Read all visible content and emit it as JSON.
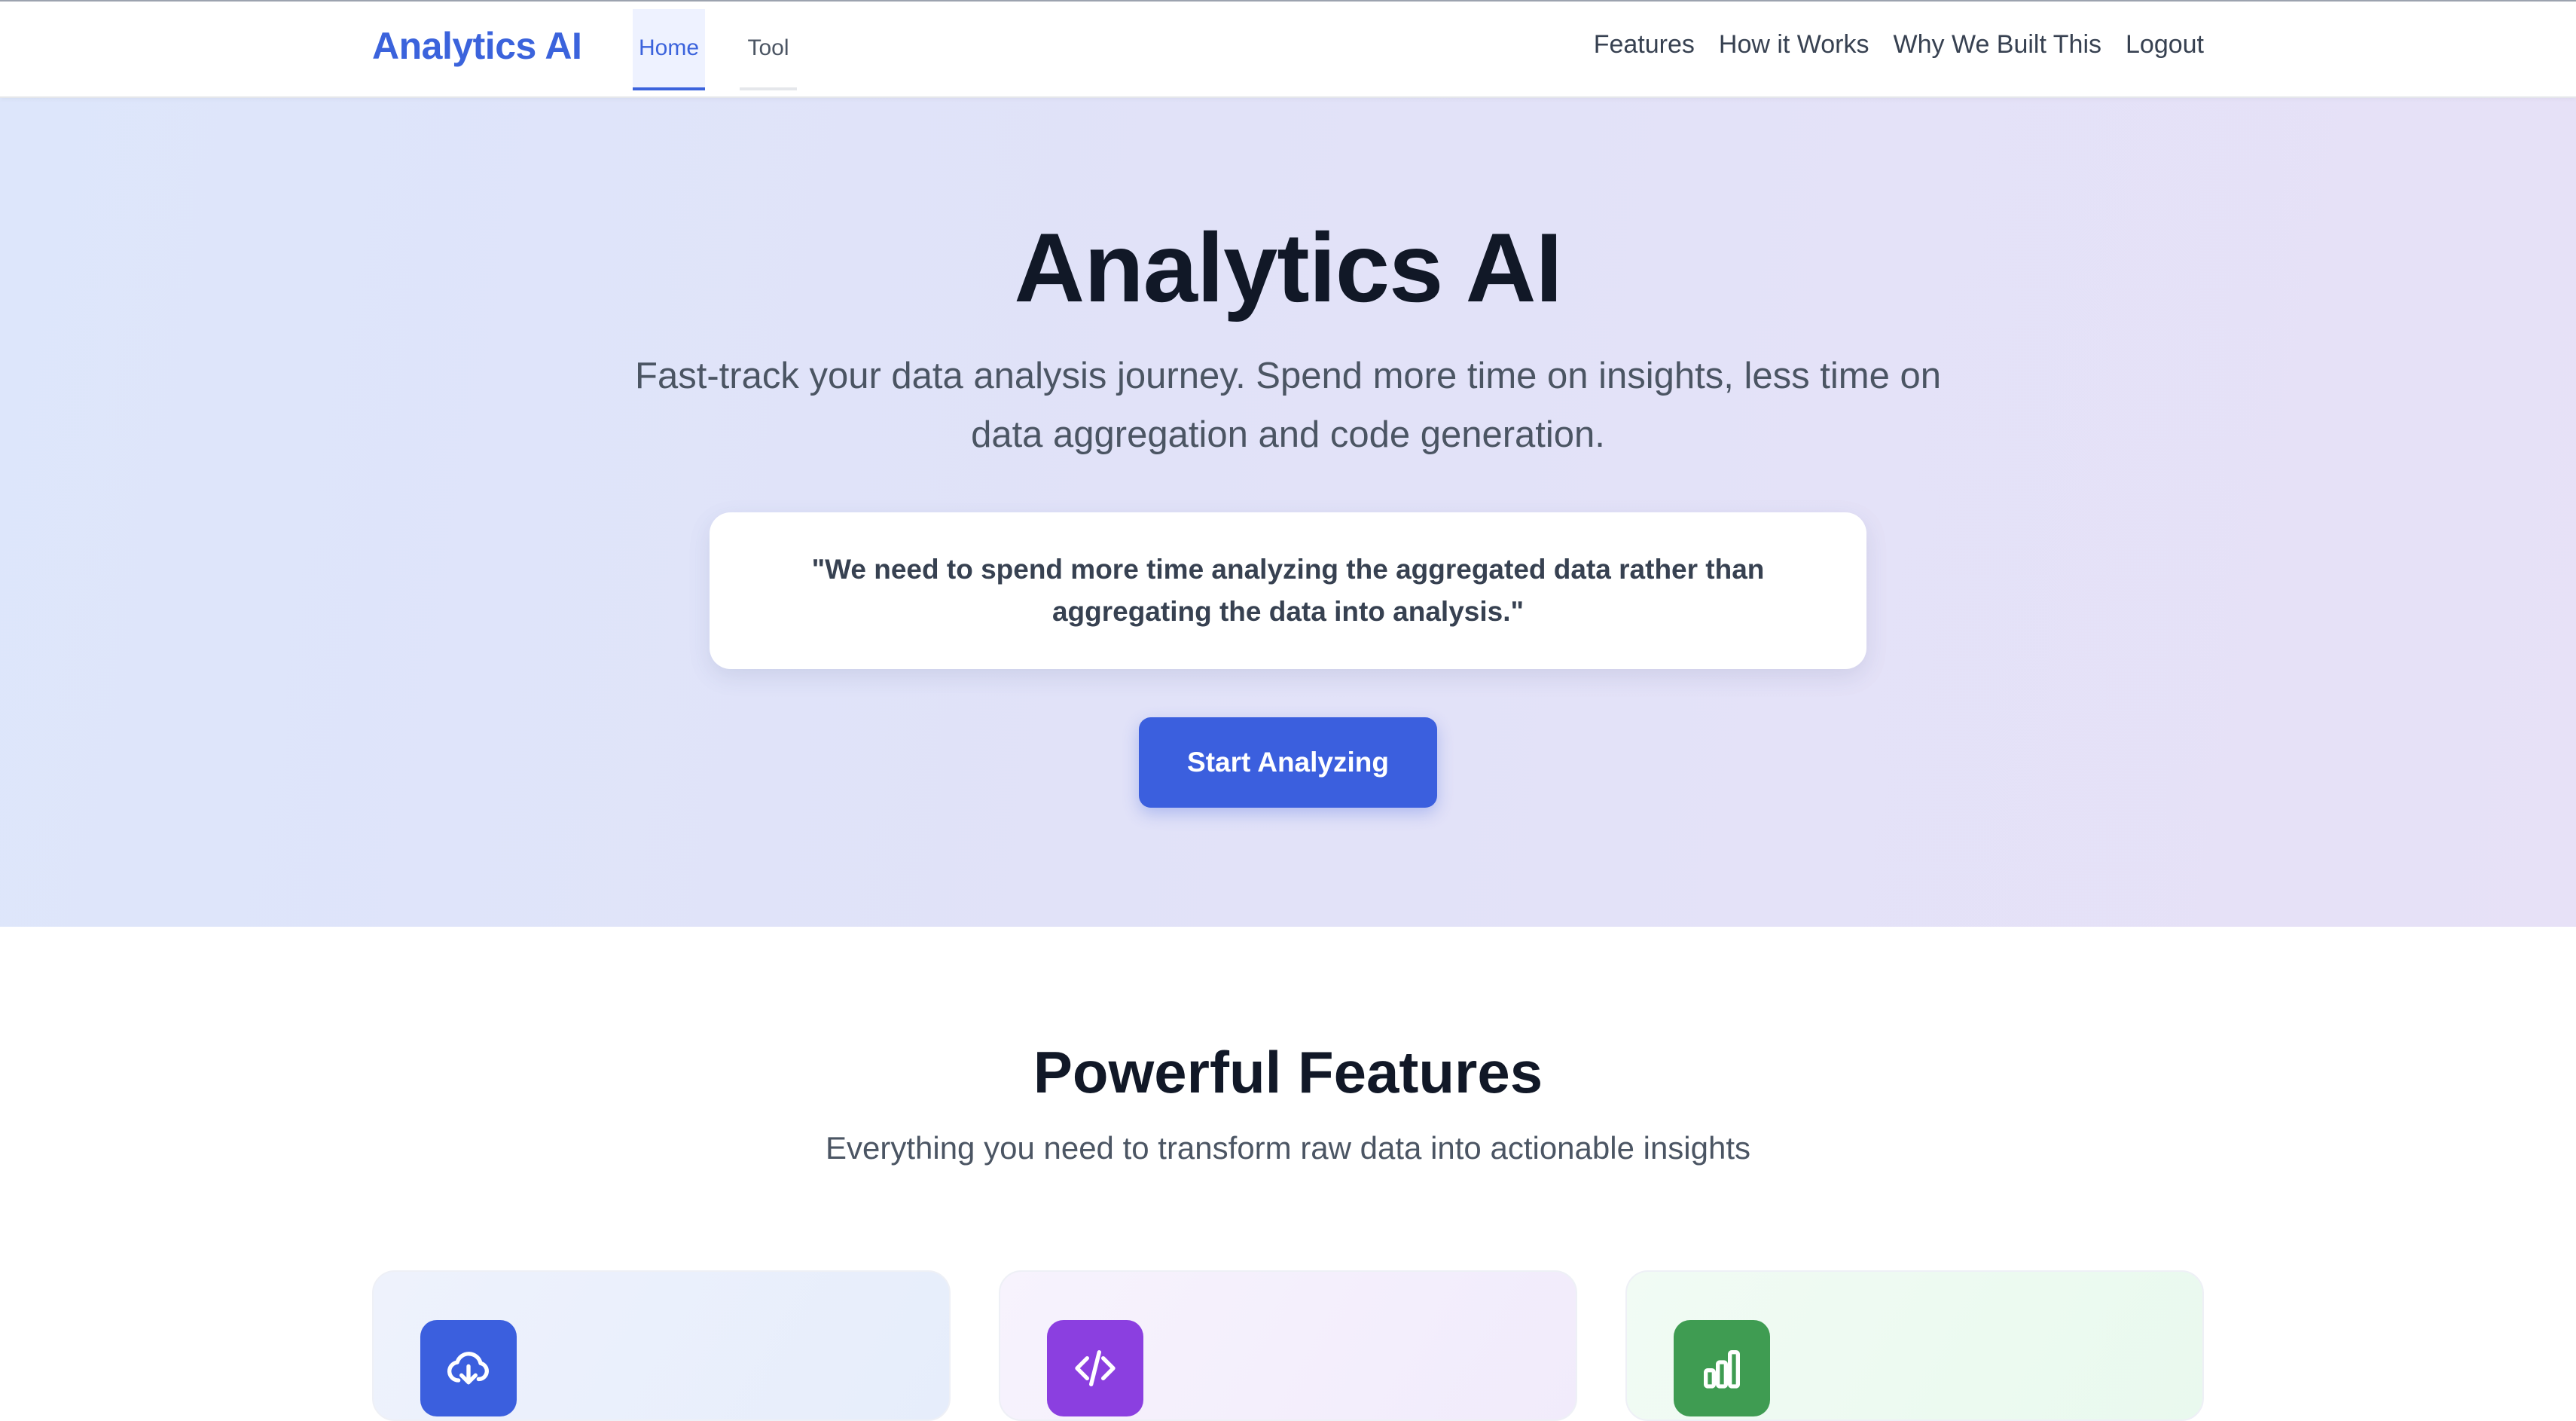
{
  "nav": {
    "brand": "Analytics AI",
    "tabs": [
      {
        "label": "Home",
        "active": true
      },
      {
        "label": "Tool",
        "active": false
      }
    ],
    "links": [
      "Features",
      "How it Works",
      "Why We Built This",
      "Logout"
    ]
  },
  "hero": {
    "title": "Analytics AI",
    "subtitle": "Fast-track your data analysis journey. Spend more time on insights, less time on data aggregation and code generation.",
    "quote": "\"We need to spend more time analyzing the aggregated data rather than aggregating the data into analysis.\"",
    "cta_label": "Start Analyzing"
  },
  "features": {
    "title": "Powerful Features",
    "subtitle": "Everything you need to transform raw data into actionable insights",
    "cards": [
      {
        "icon": "cloud-download-icon",
        "color": "#3b5fde"
      },
      {
        "icon": "code-icon",
        "color": "#8b3fe0"
      },
      {
        "icon": "bar-chart-icon",
        "color": "#3f9c52"
      }
    ]
  },
  "colors": {
    "brand": "#3b63dc",
    "primary_button": "#3b5fde",
    "heading": "#111827",
    "body_text": "#4b5563"
  }
}
